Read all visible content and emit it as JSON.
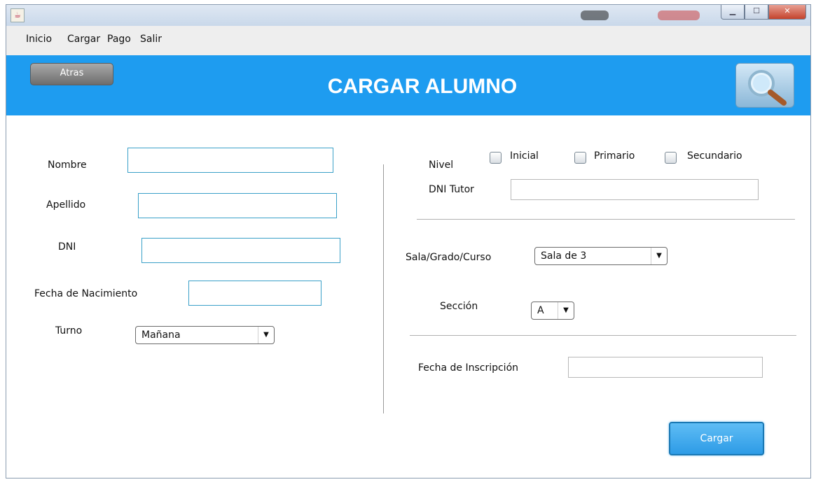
{
  "menu": {
    "items": [
      "Inicio",
      "Cargar",
      "Pago",
      "Salir"
    ]
  },
  "header": {
    "back_label": "Atras",
    "title": "CARGAR ALUMNO",
    "search_icon": "search-icon",
    "color": "#1e9cf0"
  },
  "left_form": {
    "nombre_label": "Nombre",
    "apellido_label": "Apellido",
    "dni_label": "DNI",
    "fecha_nac_label": "Fecha de Nacimiento",
    "turno_label": "Turno",
    "turno_value": "Mañana"
  },
  "right_form": {
    "nivel_label": "Nivel",
    "nivel_options": [
      "Inicial",
      "Primario",
      "Secundario"
    ],
    "dni_tutor_label": "DNI Tutor",
    "sala_label": "Sala/Grado/Curso",
    "sala_value": "Sala de 3",
    "seccion_label": "Sección",
    "seccion_value": "A",
    "fecha_insc_label": "Fecha de Inscripción"
  },
  "submit_label": "Cargar"
}
